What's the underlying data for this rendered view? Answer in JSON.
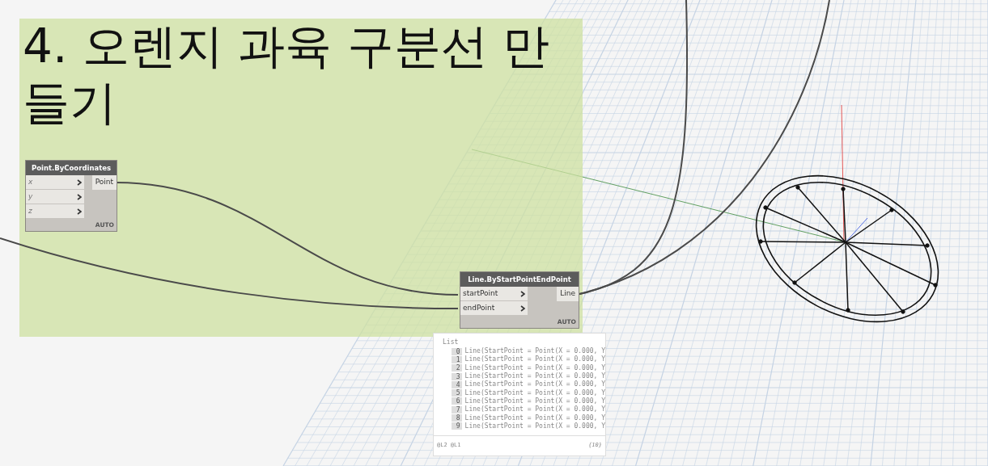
{
  "group": {
    "title": "4. 오렌지 과육 구분선 만들기"
  },
  "nodes": [
    {
      "title": "Point.ByCoordinates",
      "inputs": [
        {
          "name": "x",
          "default": true
        },
        {
          "name": "y",
          "default": true
        },
        {
          "name": "z",
          "default": true
        }
      ],
      "outputs": [
        "Point"
      ],
      "lacing": "AUTO"
    },
    {
      "title": "Line.ByStartPointEndPoint",
      "inputs": [
        {
          "name": "startPoint",
          "default": false
        },
        {
          "name": "endPoint",
          "default": false
        }
      ],
      "outputs": [
        "Line"
      ],
      "lacing": "AUTO"
    }
  ],
  "preview": {
    "header": "List",
    "items": [
      {
        "index": "0",
        "text": "Line(StartPoint = Point(X = 0.000, Y"
      },
      {
        "index": "1",
        "text": "Line(StartPoint = Point(X = 0.000, Y"
      },
      {
        "index": "2",
        "text": "Line(StartPoint = Point(X = 0.000, Y"
      },
      {
        "index": "3",
        "text": "Line(StartPoint = Point(X = 0.000, Y"
      },
      {
        "index": "4",
        "text": "Line(StartPoint = Point(X = 0.000, Y"
      },
      {
        "index": "5",
        "text": "Line(StartPoint = Point(X = 0.000, Y"
      },
      {
        "index": "6",
        "text": "Line(StartPoint = Point(X = 0.000, Y"
      },
      {
        "index": "7",
        "text": "Line(StartPoint = Point(X = 0.000, Y"
      },
      {
        "index": "8",
        "text": "Line(StartPoint = Point(X = 0.000, Y"
      },
      {
        "index": "9",
        "text": "Line(StartPoint = Point(X = 0.000, Y"
      }
    ],
    "levels": "@L2 @L1",
    "count": "{10}"
  }
}
